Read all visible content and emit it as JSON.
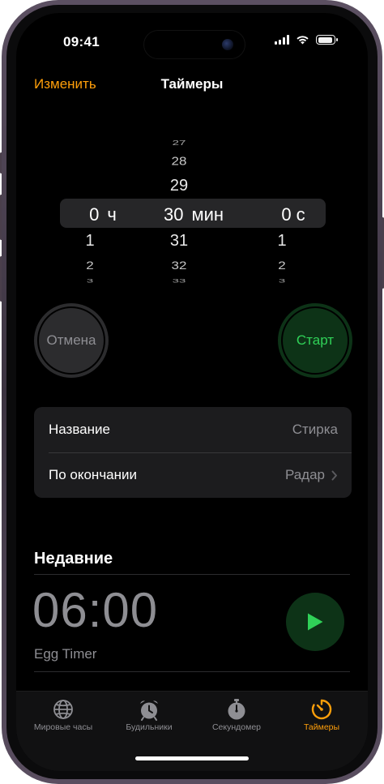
{
  "status_bar": {
    "time": "09:41"
  },
  "nav": {
    "edit_label": "Изменить",
    "title": "Таймеры"
  },
  "picker": {
    "hours": {
      "above": [
        "",
        "",
        ""
      ],
      "selected": "0",
      "unit": "ч",
      "below": [
        "1",
        "2",
        "3"
      ]
    },
    "minutes": {
      "above": [
        "27",
        "28",
        "29"
      ],
      "selected": "30",
      "unit": "мин",
      "below": [
        "31",
        "32",
        "33"
      ]
    },
    "seconds": {
      "above": [
        "",
        "",
        ""
      ],
      "selected": "0",
      "unit": "с",
      "below": [
        "1",
        "2",
        "3"
      ]
    }
  },
  "buttons": {
    "cancel_label": "Отмена",
    "start_label": "Старт"
  },
  "settings": {
    "label_row": {
      "label": "Название",
      "value": "Стирка"
    },
    "ending_row": {
      "label": "По окончании",
      "value": "Радар"
    }
  },
  "recents": {
    "title": "Недавние",
    "items": [
      {
        "time": "06:00",
        "label": "Egg Timer"
      }
    ]
  },
  "tabbar": {
    "tabs": [
      {
        "label": "Мировые часы",
        "icon": "globe-icon"
      },
      {
        "label": "Будильники",
        "icon": "alarm-clock-icon"
      },
      {
        "label": "Секундомер",
        "icon": "stopwatch-icon"
      },
      {
        "label": "Таймеры",
        "icon": "timer-icon",
        "active": true
      }
    ]
  },
  "colors": {
    "accent": "#ff9f0a",
    "start_green": "#30d158",
    "secondary_text": "#8e8e93"
  }
}
